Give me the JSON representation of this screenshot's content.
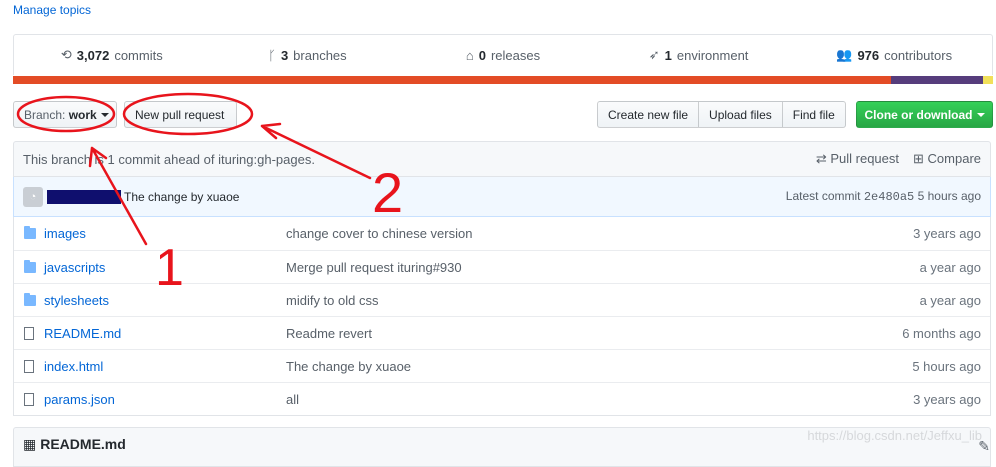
{
  "manage_topics": "Manage topics",
  "stats": {
    "commits": {
      "count": "3,072",
      "label": "commits"
    },
    "branches": {
      "count": "3",
      "label": "branches"
    },
    "releases": {
      "count": "0",
      "label": "releases"
    },
    "environment": {
      "count": "1",
      "label": "environment"
    },
    "contributors": {
      "count": "976",
      "label": "contributors"
    }
  },
  "language_colors": [
    "#e34c26",
    "#563d7c",
    "#f1e05a"
  ],
  "toolbar": {
    "branch_prefix": "Branch:",
    "branch_name": "work",
    "new_pr": "New pull request",
    "create_file": "Create new file",
    "upload_files": "Upload files",
    "find_file": "Find file",
    "clone": "Clone or download"
  },
  "branch_info": {
    "text": "This branch is 1 commit ahead of ituring:gh-pages.",
    "pull_request": "Pull request",
    "compare": "Compare"
  },
  "latest_commit": {
    "message": "The change by xuaoe",
    "label": "Latest commit",
    "sha": "2e480a5",
    "time": "5 hours ago"
  },
  "files": [
    {
      "name": "images",
      "type": "folder",
      "message": "change cover to chinese version",
      "age": "3 years ago"
    },
    {
      "name": "javascripts",
      "type": "folder",
      "message": "Merge pull request ituring#930",
      "age": "a year ago"
    },
    {
      "name": "stylesheets",
      "type": "folder",
      "message": "midify to old css",
      "age": "a year ago"
    },
    {
      "name": "README.md",
      "type": "file",
      "message": "Readme revert",
      "age": "6 months ago"
    },
    {
      "name": "index.html",
      "type": "file",
      "message": "The change by xuaoe",
      "age": "5 hours ago"
    },
    {
      "name": "params.json",
      "type": "file",
      "message": "all",
      "age": "3 years ago"
    }
  ],
  "readme_title": "README.md",
  "watermark": "https://blog.csdn.net/Jeffxu_lib",
  "annotations": {
    "label_1": "1",
    "label_2": "2"
  }
}
